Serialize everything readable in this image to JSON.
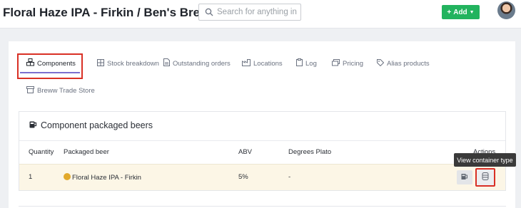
{
  "header": {
    "title": "Floral Haze IPA - Firkin / Ben's Brewery",
    "search_placeholder": "Search for anything in B",
    "add_label": "Add"
  },
  "tabs": [
    {
      "label": "Components",
      "icon": "components-icon",
      "active": true
    },
    {
      "label": "Stock breakdown",
      "icon": "stock-icon"
    },
    {
      "label": "Outstanding orders",
      "icon": "document-icon"
    },
    {
      "label": "Locations",
      "icon": "factory-icon"
    },
    {
      "label": "Log",
      "icon": "clipboard-icon"
    },
    {
      "label": "Pricing",
      "icon": "pricing-icon"
    },
    {
      "label": "Alias products",
      "icon": "tag-icon"
    },
    {
      "label": "Breww Trade Store",
      "icon": "store-icon"
    }
  ],
  "panel": {
    "title": "Component packaged beers",
    "columns": [
      "Quantity",
      "Packaged beer",
      "ABV",
      "Degrees Plato",
      "Actions"
    ],
    "rows": [
      {
        "quantity": "1",
        "packaged_beer": "Floral Haze IPA - Firkin",
        "abv": "5%",
        "degrees_plato": "-"
      }
    ]
  },
  "tooltip": "View container type",
  "colors": {
    "accent_green": "#22b35e",
    "highlight_red": "#d93025",
    "row_highlight": "#fcf6e6",
    "tab_underline": "#7b6fcf"
  }
}
